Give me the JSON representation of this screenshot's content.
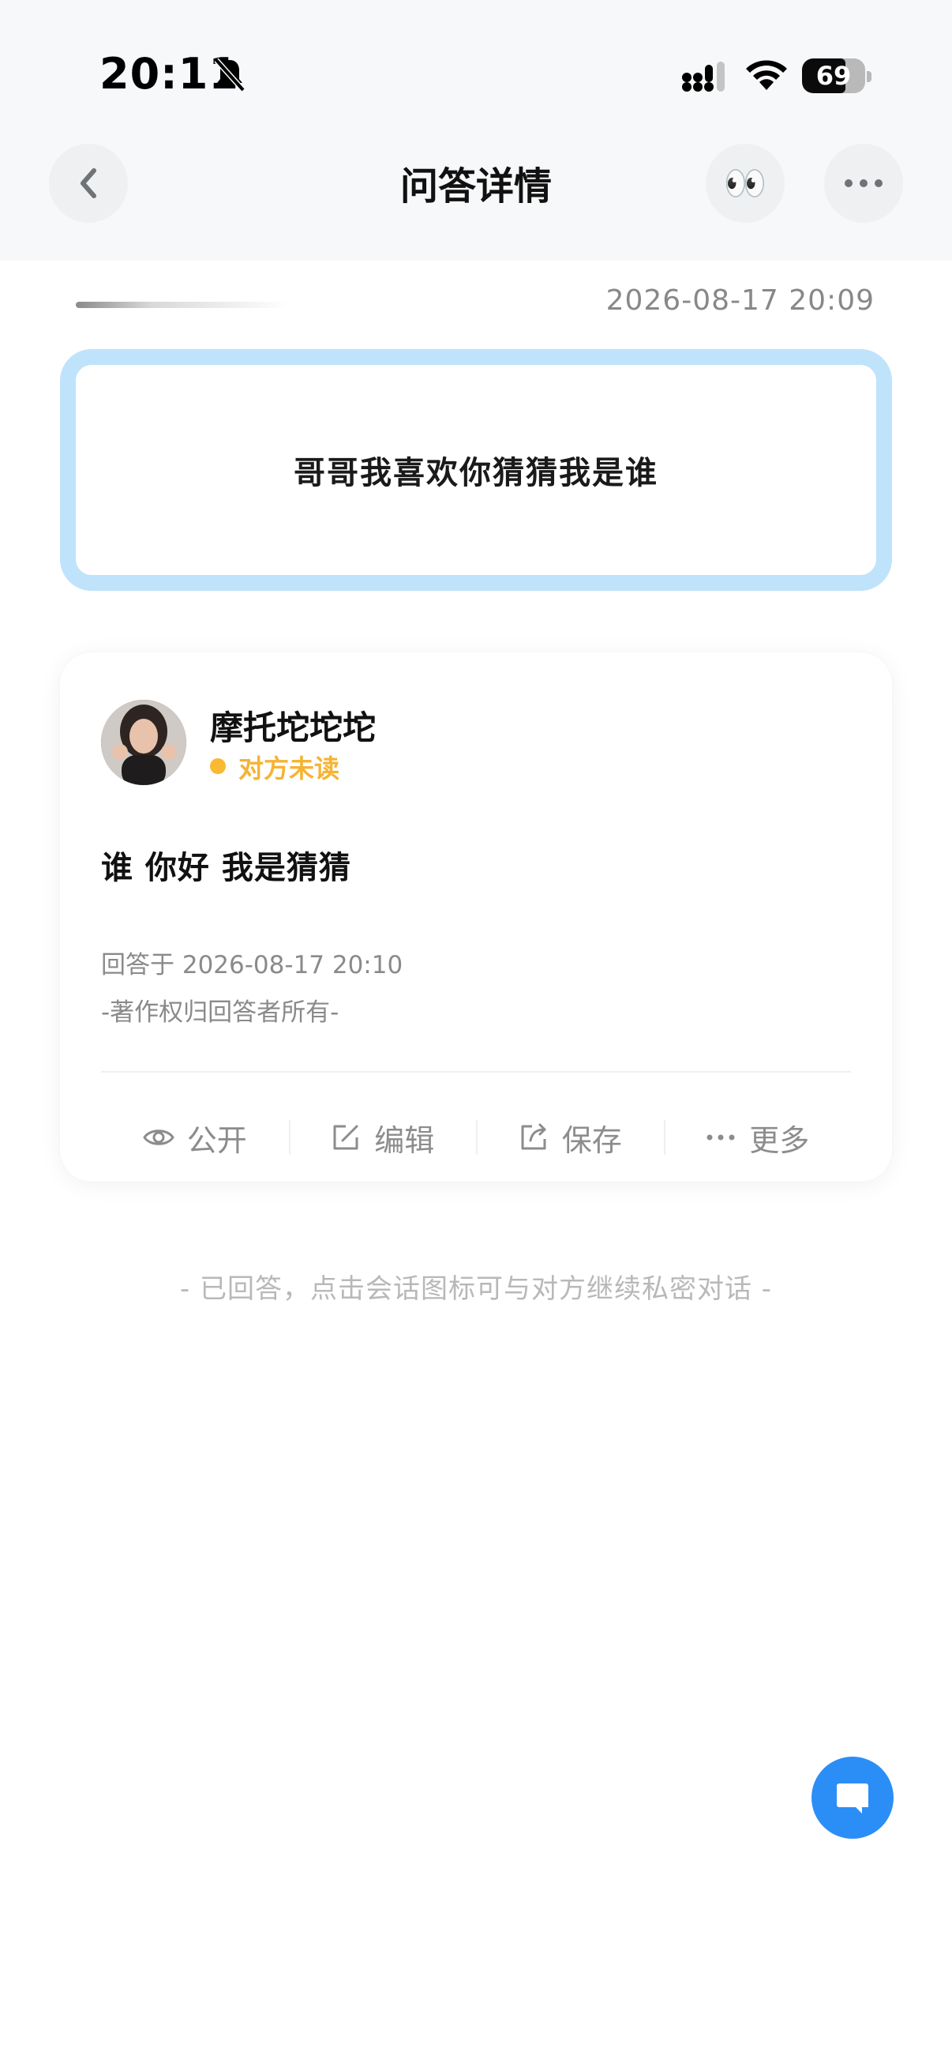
{
  "status_bar": {
    "time": "20:11",
    "battery": "69",
    "battery_level": 0.69,
    "icons": [
      "bell-muted-icon",
      "signal-icon",
      "wifi-icon",
      "battery-icon"
    ]
  },
  "nav": {
    "title": "问答详情",
    "back_icon": "chevron-left-icon",
    "eyes_emoji": "👀",
    "more_icon": "more-horizontal-icon"
  },
  "question": {
    "time": "2026-08-17 20:09",
    "text": "哥哥我喜欢你猜猜我是谁"
  },
  "answer": {
    "author": "摩托坨坨坨",
    "read_status": "对方未读",
    "text": "谁 你好 我是猜猜",
    "answered_at": "回答于 2026-08-17 20:10",
    "copyright": "-著作权归回答者所有-",
    "actions": [
      {
        "label": "公开",
        "icon": "eye-icon"
      },
      {
        "label": "编辑",
        "icon": "edit-icon"
      },
      {
        "label": "保存",
        "icon": "share-icon"
      },
      {
        "label": "更多",
        "icon": "more-icon"
      }
    ]
  },
  "footer_hint": "- 已回答，点击会话图标可与对方继续私密对话 -",
  "colors": {
    "accent_blue": "#2b8ef6",
    "question_border": "#bfe3fb",
    "unread_yellow": "#f5b335"
  }
}
